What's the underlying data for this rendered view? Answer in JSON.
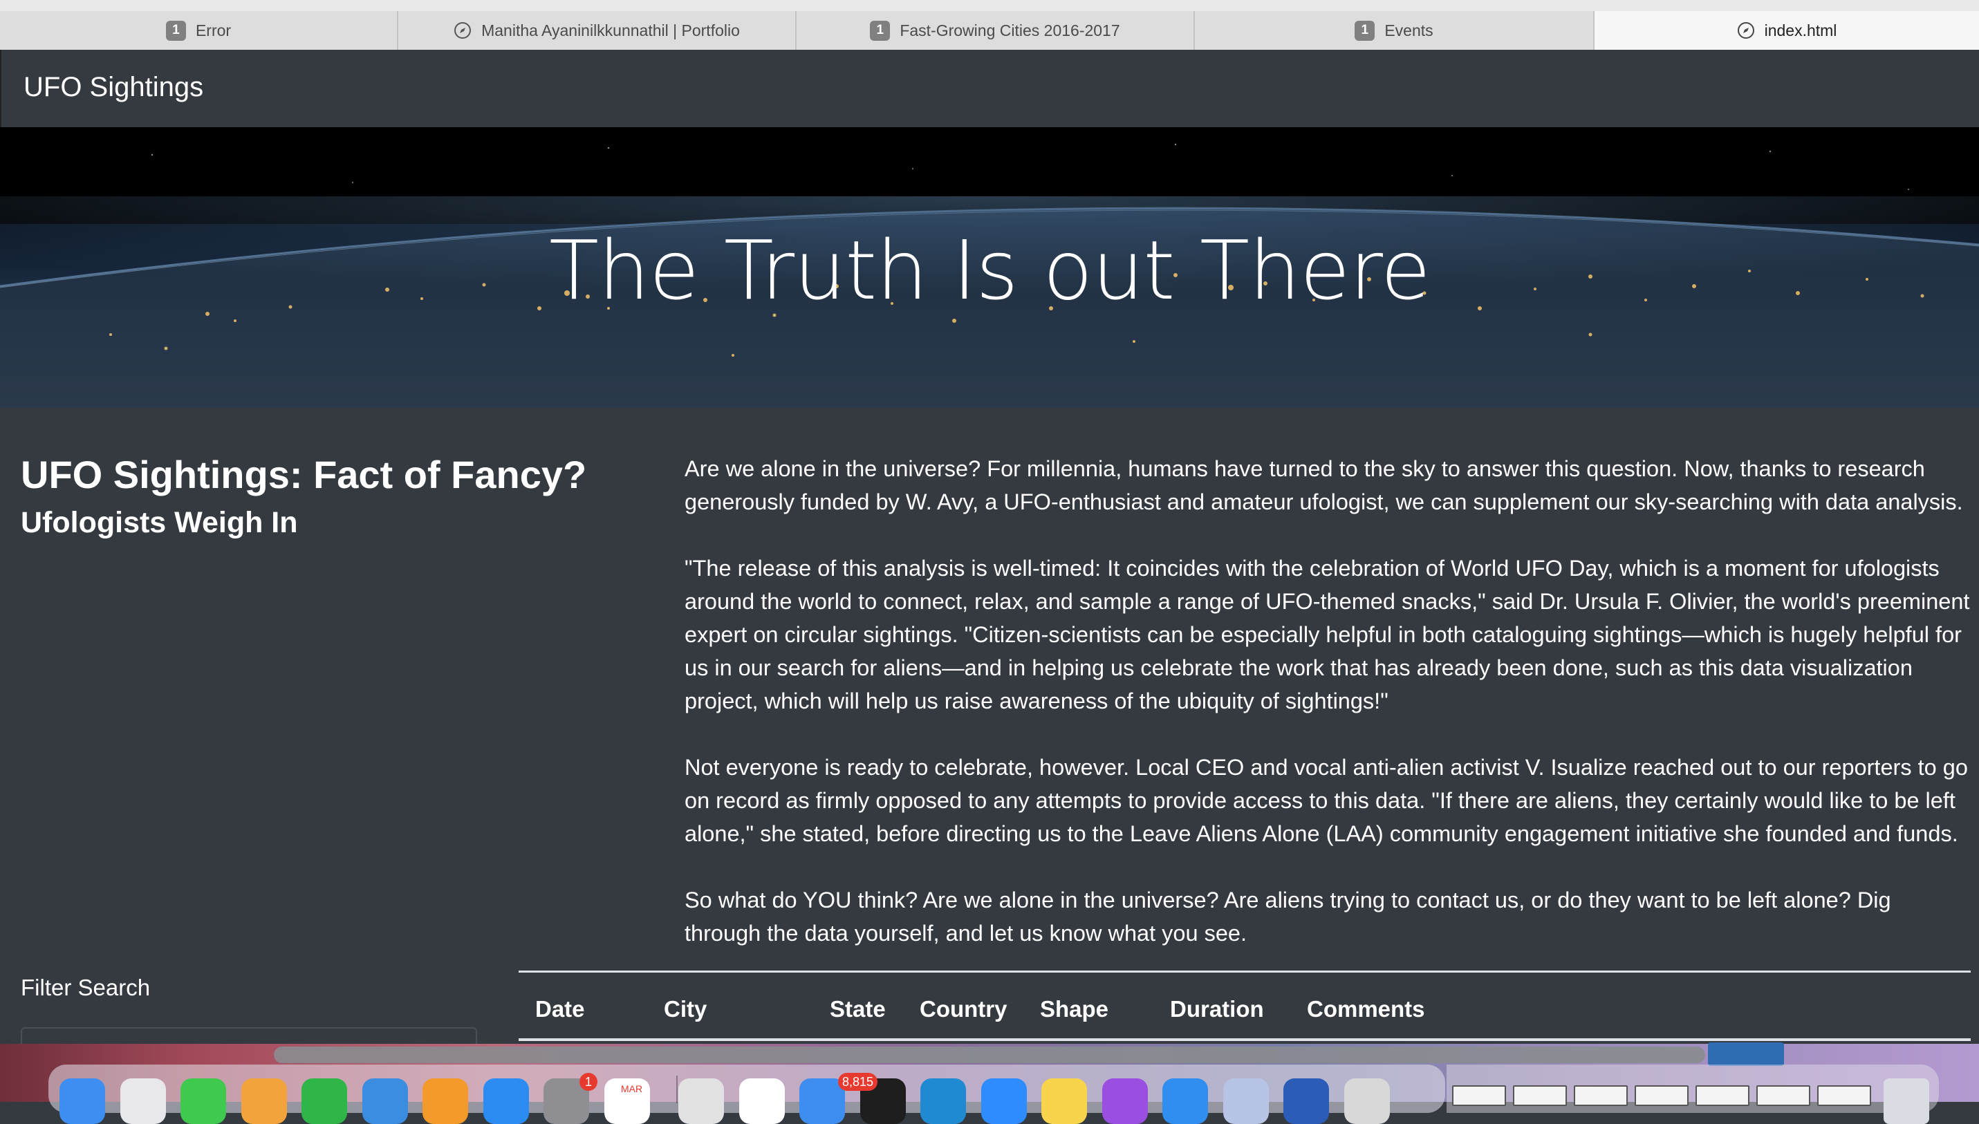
{
  "browser": {
    "tabs": [
      {
        "label": "Error",
        "icon": "badge-icon",
        "badge": "1"
      },
      {
        "label": "Manitha Ayaninilkkunnathil | Portfolio",
        "icon": "compass-icon",
        "badge": ""
      },
      {
        "label": "Fast-Growing Cities 2016-2017",
        "icon": "badge-icon",
        "badge": "1"
      },
      {
        "label": "Events",
        "icon": "badge-icon",
        "badge": "1"
      },
      {
        "label": "index.html",
        "icon": "compass-icon",
        "badge": ""
      }
    ]
  },
  "navbar": {
    "brand": "UFO Sightings"
  },
  "hero": {
    "title": "The Truth Is out There"
  },
  "article": {
    "title": "UFO Sightings: Fact of Fancy?",
    "subtitle": "Ufologists Weigh In",
    "paragraphs": [
      "Are we alone in the universe? For millennia, humans have turned to the sky to answer this question. Now, thanks to research generously funded by W. Avy, a UFO-enthusiast and amateur ufologist, we can supplement our sky-searching with data analysis.",
      "\"The release of this analysis is well-timed: It coincides with the celebration of World UFO Day, which is a moment for ufologists around the world to connect, relax, and sample a range of UFO-themed snacks,\" said Dr. Ursula F. Olivier, the world's preeminent expert on circular sightings. \"Citizen-scientists can be especially helpful in both cataloguing sightings—which is hugely helpful for us in our search for aliens—and in helping us celebrate the work that has already been done, such as this data visualization project, which will help us raise awareness of the ubiquity of sightings!\"",
      "Not everyone is ready to celebrate, however. Local CEO and vocal anti-alien activist V. Isualize reached out to our reporters to go on record as firmly opposed to any attempts to provide access to this data. \"If there are aliens, they certainly would like to be left alone,\" she stated, before directing us to the Leave Aliens Alone (LAA) community engagement initiative she founded and funds.",
      "So what do YOU think? Are we alone in the universe? Are aliens trying to contact us, or do they want to be left alone? Dig through the data yourself, and let us know what you see."
    ]
  },
  "filter": {
    "heading": "Filter Search"
  },
  "table": {
    "headers": [
      "Date",
      "City",
      "State",
      "Country",
      "Shape",
      "Duration",
      "Comments"
    ]
  },
  "dock": {
    "apps": [
      {
        "name": "finder-icon",
        "color": "#3d8ef0"
      },
      {
        "name": "launchpad-icon",
        "color": "#e8e8ec"
      },
      {
        "name": "messages-icon",
        "color": "#3fc94f"
      },
      {
        "name": "photos-icon",
        "color": "#f2a33c"
      },
      {
        "name": "numbers-icon",
        "color": "#30b548"
      },
      {
        "name": "keynote-icon",
        "color": "#3a8de0"
      },
      {
        "name": "pages-icon",
        "color": "#f39a2b"
      },
      {
        "name": "app-store-icon",
        "color": "#2a8cf2"
      },
      {
        "name": "system-preferences-icon",
        "color": "#8e8e93"
      },
      {
        "name": "calendar-icon",
        "color": "#ffffff"
      },
      {
        "name": "chrome-icon",
        "color": "#e2e2e2"
      },
      {
        "name": "slack-icon",
        "color": "#ffffff"
      },
      {
        "name": "mail-icon",
        "color": "#3d8ef0"
      },
      {
        "name": "terminal-icon",
        "color": "#1e1e1e"
      },
      {
        "name": "vscode-icon",
        "color": "#1f8ad2"
      },
      {
        "name": "zoom-icon",
        "color": "#2d8cff"
      },
      {
        "name": "notes-icon",
        "color": "#f7d44c"
      },
      {
        "name": "podcasts-icon",
        "color": "#9b4fe0"
      },
      {
        "name": "safari-icon",
        "color": "#2f8ef0"
      },
      {
        "name": "preview-icon",
        "color": "#b8c4e6"
      },
      {
        "name": "word-icon",
        "color": "#2b5cb8"
      },
      {
        "name": "tools-icon",
        "color": "#d8d8d8"
      }
    ],
    "badges": {
      "system_preferences": "1",
      "calendar_month": "MAR",
      "mail_count": "8,815"
    }
  }
}
